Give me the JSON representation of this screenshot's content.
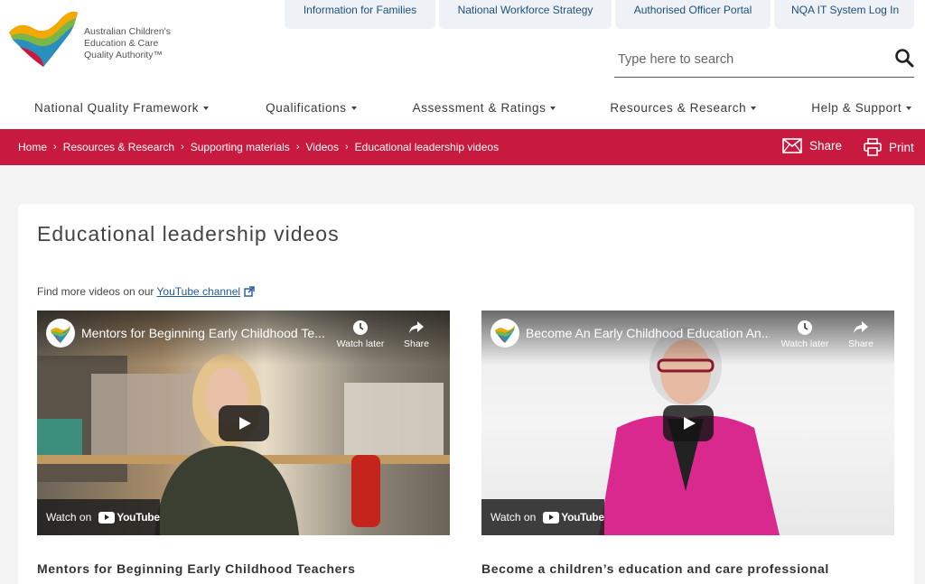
{
  "brand": {
    "name_line1": "Australian Children's",
    "name_line2": "Education & Care",
    "name_line3": "Quality Authority™"
  },
  "top_links": [
    {
      "label": "Information for Families"
    },
    {
      "label": "National Workforce Strategy"
    },
    {
      "label": "Authorised Officer Portal"
    },
    {
      "label": "NQA IT System Log In"
    }
  ],
  "search": {
    "placeholder": "Type here to search"
  },
  "main_nav": [
    {
      "label": "National Quality Framework"
    },
    {
      "label": "Qualifications"
    },
    {
      "label": "Assessment & Ratings"
    },
    {
      "label": "Resources & Research"
    },
    {
      "label": "Help & Support"
    }
  ],
  "breadcrumb": [
    {
      "label": "Home"
    },
    {
      "label": "Resources & Research"
    },
    {
      "label": "Supporting materials"
    },
    {
      "label": "Videos"
    },
    {
      "label": "Educational leadership videos"
    }
  ],
  "actions": {
    "share": "Share",
    "print": "Print"
  },
  "page": {
    "title": "Educational leadership videos",
    "find_more_prefix": "Find more videos on our",
    "find_more_link": "YouTube channel"
  },
  "videos": [
    {
      "player_title": "Mentors for Beginning Early Childhood Te...",
      "watch_later": "Watch later",
      "share": "Share",
      "watch_on": "Watch on",
      "youtube": "YouTube",
      "caption": "Mentors for Beginning Early Childhood Teachers"
    },
    {
      "player_title": "Become An Early Childhood Education An...",
      "watch_later": "Watch later",
      "share": "Share",
      "watch_on": "Watch on",
      "youtube": "YouTube",
      "caption": "Become a children’s education and care professional"
    }
  ],
  "colors": {
    "accent_red": "#c8193f",
    "link_blue": "#1f5a99",
    "top_link_bg": "#eef1f5"
  }
}
